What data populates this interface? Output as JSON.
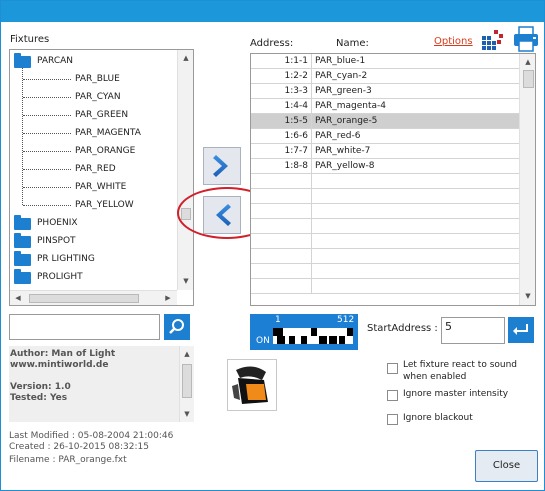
{
  "labels": {
    "fixtures": "Fixtures",
    "address": "Address:",
    "name": "Name:",
    "options": "Options",
    "start_address": "StartAddress :",
    "close": "Close"
  },
  "tree": {
    "groups": [
      {
        "label": "PARCAN",
        "expanded": true,
        "children": [
          "PAR_BLUE",
          "PAR_CYAN",
          "PAR_GREEN",
          "PAR_MAGENTA",
          "PAR_ORANGE",
          "PAR_RED",
          "PAR_WHITE",
          "PAR_YELLOW"
        ]
      },
      {
        "label": "PHOENIX"
      },
      {
        "label": "PINSPOT"
      },
      {
        "label": "PR LIGHTING"
      },
      {
        "label": "PROLIGHT"
      }
    ]
  },
  "patch": {
    "rows": [
      {
        "address": "1:1-1",
        "name": "PAR_blue-1"
      },
      {
        "address": "1:2-2",
        "name": "PAR_cyan-2"
      },
      {
        "address": "1:3-3",
        "name": "PAR_green-3"
      },
      {
        "address": "1:4-4",
        "name": "PAR_magenta-4"
      },
      {
        "address": "1:5-5",
        "name": "PAR_orange-5",
        "selected": true
      },
      {
        "address": "1:6-6",
        "name": "PAR_red-6"
      },
      {
        "address": "1:7-7",
        "name": "PAR_white-7"
      },
      {
        "address": "1:8-8",
        "name": "PAR_yellow-8"
      }
    ]
  },
  "search": {
    "value": ""
  },
  "info": {
    "author": "Author: Man of Light",
    "website": "www.mintiworld.de",
    "version": "Version: 1.0",
    "tested": "Tested: Yes"
  },
  "footer": {
    "last_modified": "Last Modified : 05-08-2004 21:00:46",
    "created": "Created : 26-10-2015 08:32:15",
    "filename": "Filename : PAR_orange.fxt"
  },
  "dmx": {
    "start": "1",
    "end": "512",
    "on": "ON"
  },
  "start_address_value": "5",
  "checkboxes": {
    "react_sound": "Let fixture react to sound when enabled",
    "ignore_master": "Ignore master intensity",
    "ignore_blackout": "Ignore blackout"
  },
  "colors": {
    "accent": "#1c98da",
    "folder": "#1d7fd0",
    "options_link": "#d93b1a",
    "annotation_circle": "#d0202a",
    "selected_row": "#cfcfcf"
  },
  "icons": [
    "matrix-icon",
    "printer-icon",
    "search-icon",
    "arrow-right-icon",
    "arrow-left-icon",
    "enter-icon",
    "fixture-preview-icon"
  ]
}
